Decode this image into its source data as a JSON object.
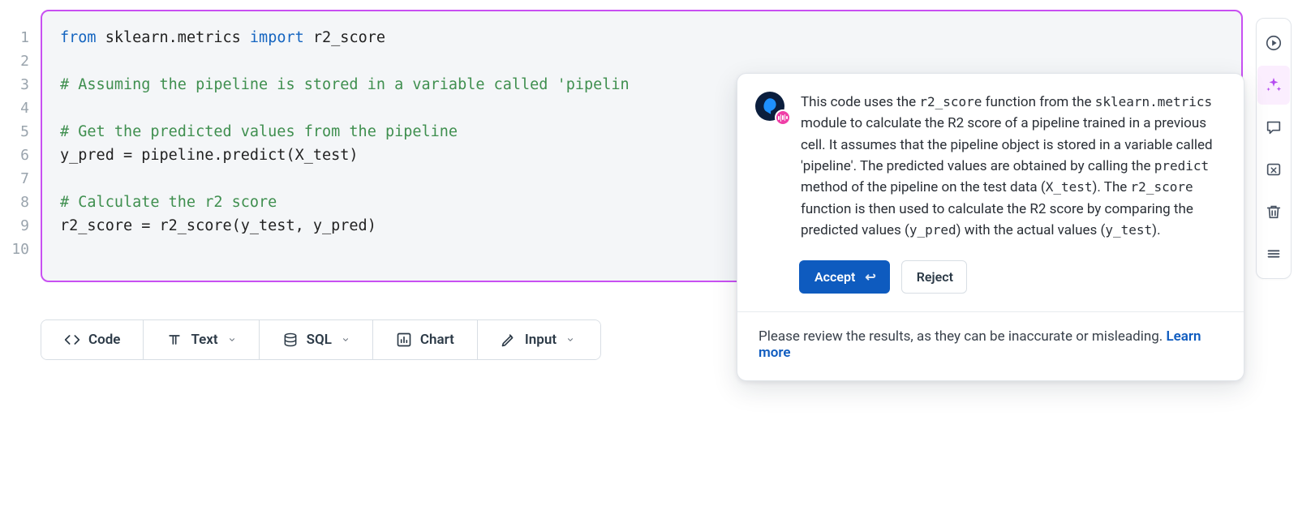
{
  "editor": {
    "line_count": 10,
    "tokens": [
      [
        {
          "t": "from",
          "c": "kw"
        },
        {
          "t": " sklearn.metrics "
        },
        {
          "t": "import",
          "c": "kw"
        },
        {
          "t": " r2_score"
        }
      ],
      [],
      [
        {
          "t": "# Assuming the pipeline is stored in a variable called 'pipelin",
          "c": "cm"
        }
      ],
      [],
      [
        {
          "t": "# Get the predicted values from the pipeline",
          "c": "cm"
        }
      ],
      [
        {
          "t": "y_pred = pipeline.predict(X_test)"
        }
      ],
      [],
      [
        {
          "t": "# Calculate the r2 score",
          "c": "cm"
        }
      ],
      [
        {
          "t": "r2_score = r2_score(y_test, y_pred)"
        }
      ],
      []
    ]
  },
  "toolbar": {
    "code_label": "Code",
    "text_label": "Text",
    "sql_label": "SQL",
    "chart_label": "Chart",
    "input_label": "Input"
  },
  "assistant": {
    "explanation_html": "This code uses the `r2_score` function from the `sklearn.metrics` module to calculate the R2 score of a pipeline trained in a previous cell. It assumes that the pipeline object is stored in a variable called 'pipeline'. The predicted values are obtained by calling the `predict` method of the pipeline on the test data (`X_test`). The `r2_score` function is then used to calculate the R2 score by comparing the predicted values (`y_pred`) with the actual values (`y_test`).",
    "accept_label": "Accept",
    "accept_shortcut": "↩",
    "reject_label": "Reject",
    "disclaimer_prefix": "Please review the results, as they can be inaccurate or misleading. ",
    "learn_more_label": "Learn more"
  },
  "rail": {
    "run": "run-icon",
    "ai": "ai-sparkle-icon",
    "comment": "comment-icon",
    "var": "variable-inspector-icon",
    "delete": "trash-icon",
    "more": "more-menu-icon"
  }
}
